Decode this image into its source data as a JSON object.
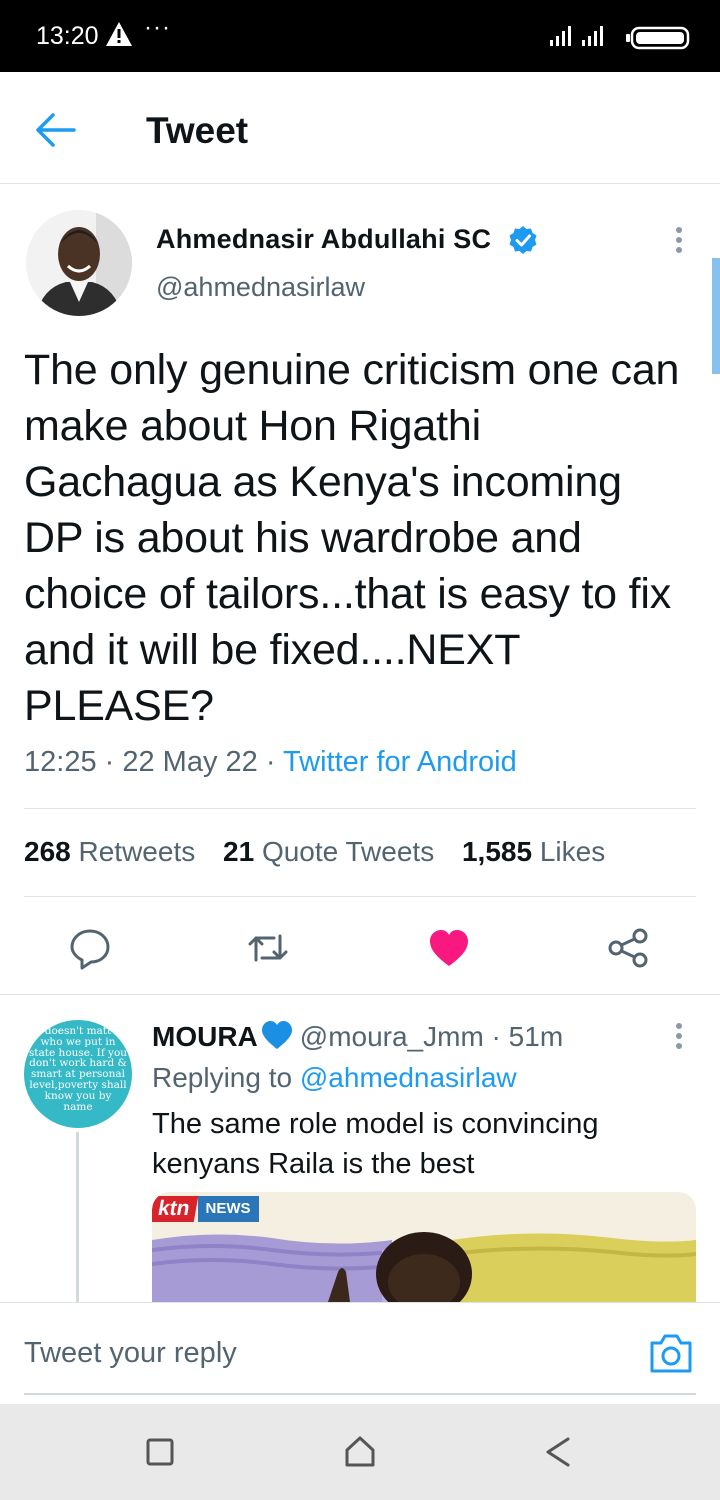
{
  "status_bar": {
    "time": "13:20",
    "dots": "···"
  },
  "header": {
    "title": "Tweet"
  },
  "tweet": {
    "author_name": "Ahmednasir Abdullahi SC",
    "author_handle": "@ahmednasirlaw",
    "text": "The only genuine criticism one can make about Hon Rigathi Gachagua as Kenya's incoming DP is about his wardrobe and choice of tailors...that is easy to fix and it will be fixed....NEXT PLEASE?",
    "time": "12:25",
    "date": "22 May 22",
    "source": "Twitter for Android",
    "meta_sep": " · ",
    "retweets_count": "268",
    "retweets_label": "Retweets",
    "quotes_count": "21",
    "quotes_label": "Quote Tweets",
    "likes_count": "1,585",
    "likes_label": "Likes",
    "liked": true
  },
  "reply": {
    "name": "MOURA",
    "handle": "@moura_Jmm",
    "time": "51m",
    "sep": " · ",
    "replying_prefix": "Replying to",
    "replying_to": "@ahmednasirlaw",
    "text": "The same role model is convincing kenyans Raila is the best",
    "avatar_lines": [
      "doesn't matt",
      "who we put in",
      "state house. If you",
      "don't work hard &",
      "smart at personal",
      "level,poverty shall",
      "know you by",
      "name"
    ],
    "media_logo_red": "ktn",
    "media_logo_news": "NEWS"
  },
  "composer": {
    "placeholder": "Tweet your reply"
  },
  "colors": {
    "accent": "#1d9bf0",
    "like": "#f91880",
    "muted": "#536471"
  }
}
